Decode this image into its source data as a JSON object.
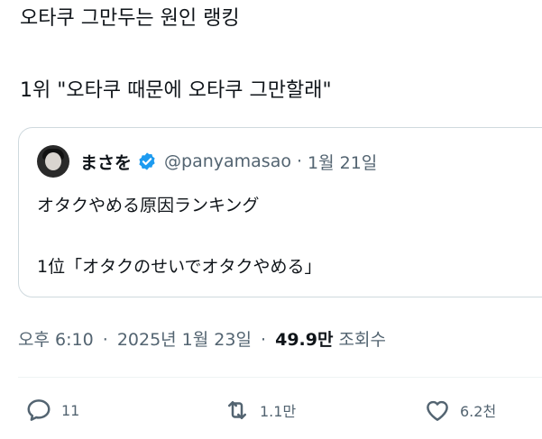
{
  "tweet": {
    "line1": "오타쿠 그만두는 원인 랭킹",
    "line2": "1위 \"오타쿠 때문에 오타쿠 그만할래\""
  },
  "quote": {
    "name": "まさを",
    "handle": "@panyamasao",
    "separator": "·",
    "date": "1월 21일",
    "body_line1": "オタクやめる原因ランキング",
    "body_line2": "1位「オタクのせいでオタクやめる」"
  },
  "meta": {
    "time": "오후 6:10",
    "sep1": "·",
    "date": "2025년 1월 23일",
    "sep2": "·",
    "views": "49.9만",
    "views_label": "조회수"
  },
  "actions": {
    "reply_count": "11",
    "retweet_count": "1.1만",
    "like_count": "6.2천"
  },
  "colors": {
    "text": "#0f1419",
    "secondary": "#536471",
    "verified": "#1d9bf0",
    "border": "#cfd9de"
  },
  "icons": [
    "verified-badge-icon",
    "reply-icon",
    "retweet-icon",
    "like-icon"
  ]
}
